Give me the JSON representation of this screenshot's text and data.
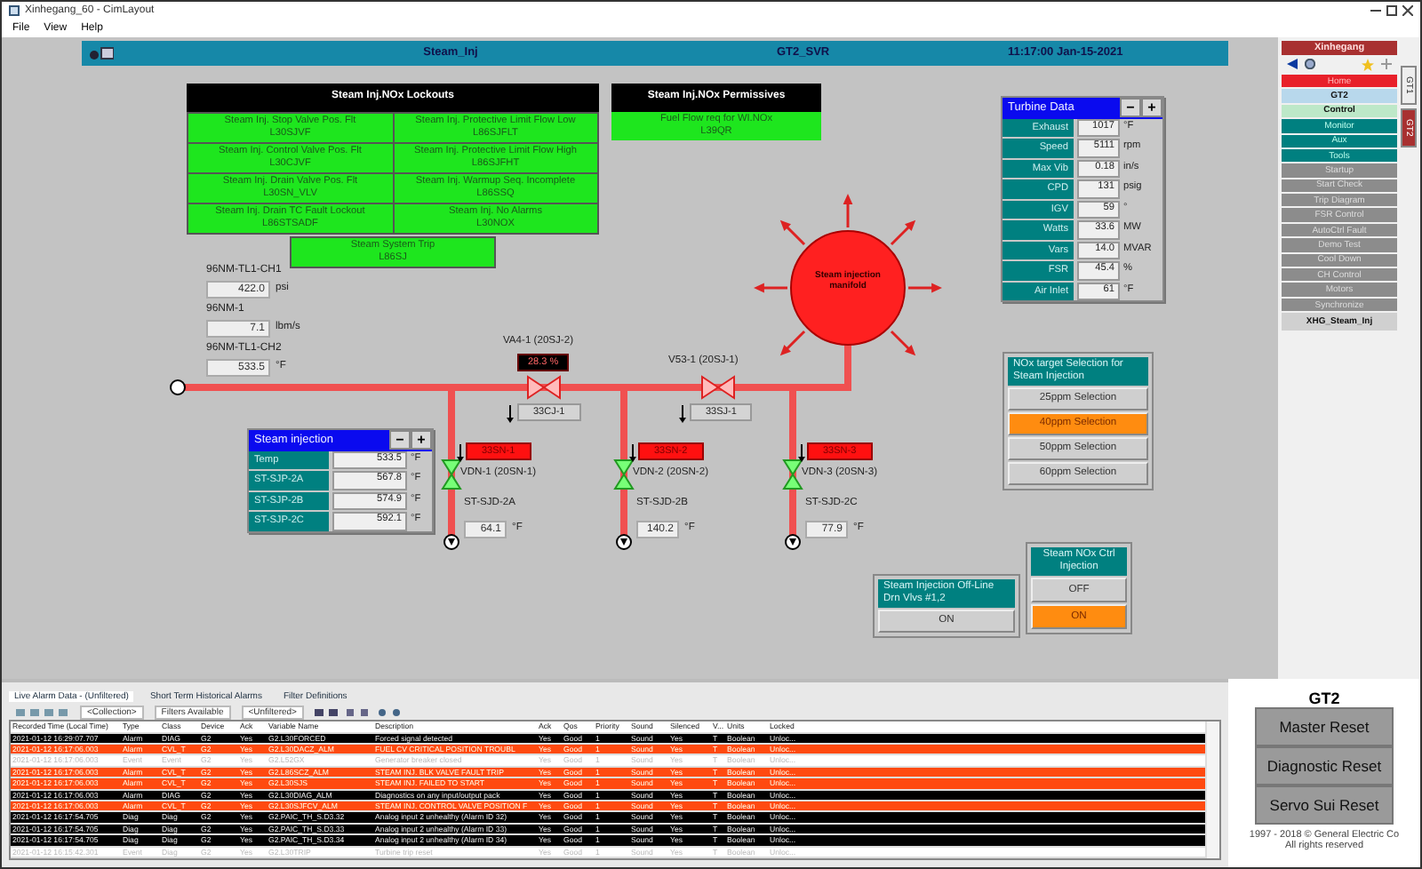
{
  "window": {
    "title": "Xinhegang_60 - CimLayout"
  },
  "menu": [
    "File",
    "View",
    "Help"
  ],
  "header": {
    "screen": "Steam_Inj",
    "server": "GT2_SVR",
    "time": "11:17:00  Jan-15-2021"
  },
  "lockouts": {
    "title": "Steam Inj.NOx Lockouts",
    "cells": [
      {
        "name": "Steam Inj. Stop Valve Pos. Flt",
        "tag": "L30SJVF"
      },
      {
        "name": "Steam Inj. Protective Limit Flow Low",
        "tag": "L86SJFLT"
      },
      {
        "name": "Steam Inj. Control Valve Pos. Flt",
        "tag": "L30CJVF"
      },
      {
        "name": "Steam Inj. Protective Limit Flow High",
        "tag": "L86SJFHT"
      },
      {
        "name": "Steam Inj. Drain Valve Pos. Flt",
        "tag": "L30SN_VLV"
      },
      {
        "name": "Steam Inj. Warmup Seq. Incomplete",
        "tag": "L86SSQ"
      },
      {
        "name": "Steam Inj. Drain TC Fault Lockout",
        "tag": "L86STSADF"
      },
      {
        "name": "Steam Inj. No Alarms",
        "tag": "L30NOX"
      }
    ],
    "trip": {
      "name": "Steam System Trip",
      "tag": "L86SJ"
    }
  },
  "permissives": {
    "title": "Steam Inj.NOx Permissives",
    "cells": [
      {
        "name": "Fuel Flow req for WI.NOx",
        "tag": "L39QR"
      }
    ]
  },
  "turbine_data": {
    "title": "Turbine Data",
    "minus": "−",
    "plus": "+",
    "rows": [
      {
        "label": "Exhaust",
        "value": "1017",
        "unit": "°F"
      },
      {
        "label": "Speed",
        "value": "5111",
        "unit": "rpm"
      },
      {
        "label": "Max Vib",
        "value": "0.18",
        "unit": "in/s"
      },
      {
        "label": "CPD",
        "value": "131",
        "unit": "psig"
      },
      {
        "label": "IGV",
        "value": "59",
        "unit": "°"
      },
      {
        "label": "Watts",
        "value": "33.6",
        "unit": "MW"
      },
      {
        "label": "Vars",
        "value": "14.0",
        "unit": "MVAR"
      },
      {
        "label": "FSR",
        "value": "45.4",
        "unit": "%"
      },
      {
        "label": "Air Inlet",
        "value": "61",
        "unit": "°F"
      }
    ]
  },
  "sensors": [
    {
      "label": "96NM-TL1-CH1",
      "value": "422.0",
      "unit": "psi"
    },
    {
      "label": "96NM-1",
      "value": "7.1",
      "unit": "lbm/s"
    },
    {
      "label": "96NM-TL1-CH2",
      "value": "533.5",
      "unit": "°F"
    }
  ],
  "manifold": {
    "label": "Steam injection manifold"
  },
  "valves": [
    {
      "label": "VA4-1 (20SJ-2)",
      "reading": "28.3 %",
      "tag": "33CJ-1"
    },
    {
      "label": "V53-1 (20SJ-1)",
      "tag": "33SJ-1"
    }
  ],
  "drains": [
    {
      "alarm": "33SN-1",
      "valve": "VDN-1 (20SN-1)",
      "sensor": "ST-SJD-2A",
      "value": "64.1",
      "unit": "°F"
    },
    {
      "alarm": "33SN-2",
      "valve": "VDN-2 (20SN-2)",
      "sensor": "ST-SJD-2B",
      "value": "140.2",
      "unit": "°F"
    },
    {
      "alarm": "33SN-3",
      "valve": "VDN-3 (20SN-3)",
      "sensor": "ST-SJD-2C",
      "value": "77.9",
      "unit": "°F"
    }
  ],
  "steam_injection": {
    "title": "Steam injection",
    "minus": "−",
    "plus": "+",
    "rows": [
      {
        "label": "Temp",
        "value": "533.5",
        "unit": "°F"
      },
      {
        "label": "ST-SJP-2A",
        "value": "567.8",
        "unit": "°F"
      },
      {
        "label": "ST-SJP-2B",
        "value": "574.9",
        "unit": "°F"
      },
      {
        "label": "ST-SJP-2C",
        "value": "592.1",
        "unit": "°F"
      }
    ]
  },
  "nox_selection": {
    "title": "NOx target Selection for Steam Injection",
    "options": [
      {
        "label": "25ppm Selection",
        "selected": false
      },
      {
        "label": "40ppm Selection",
        "selected": true
      },
      {
        "label": "50ppm Selection",
        "selected": false
      },
      {
        "label": "60ppm Selection",
        "selected": false
      }
    ]
  },
  "nox_ctrl": {
    "title": "Steam NOx Ctrl Injection",
    "options": [
      {
        "label": "OFF",
        "selected": false
      },
      {
        "label": "ON",
        "selected": true
      }
    ]
  },
  "offline_drain": {
    "title": "Steam Injection Off-Line Drn Vlvs #1,2",
    "options": [
      {
        "label": "ON",
        "selected": false
      }
    ]
  },
  "nav": {
    "site": "Xinhegang",
    "unit_tabs": [
      {
        "label": "GT1",
        "selected": false
      },
      {
        "label": "GT2",
        "selected": true
      }
    ],
    "items": [
      {
        "label": "Home",
        "kind": "home"
      },
      {
        "label": "GT2",
        "kind": "unit"
      },
      {
        "label": "Control",
        "kind": "current"
      },
      {
        "label": "Monitor",
        "kind": "group"
      },
      {
        "label": "Aux",
        "kind": "group"
      },
      {
        "label": "Tools",
        "kind": "group"
      },
      {
        "label": "Startup",
        "kind": "page"
      },
      {
        "label": "Start Check",
        "kind": "page"
      },
      {
        "label": "Trip Diagram",
        "kind": "page"
      },
      {
        "label": "FSR Control",
        "kind": "page"
      },
      {
        "label": "AutoCtrl Fault",
        "kind": "page"
      },
      {
        "label": "Demo Test",
        "kind": "page"
      },
      {
        "label": "Cool Down",
        "kind": "page"
      },
      {
        "label": "CH Control",
        "kind": "page"
      },
      {
        "label": "Motors",
        "kind": "page"
      },
      {
        "label": "Synchronize",
        "kind": "page"
      },
      {
        "label": "XHG_Steam_Inj",
        "kind": "screen"
      }
    ]
  },
  "alarms": {
    "tabs": [
      {
        "label": "Live Alarm Data - (Unfiltered)",
        "selected": true
      },
      {
        "label": "Short Term Historical Alarms",
        "selected": false
      },
      {
        "label": "Filter Definitions",
        "selected": false
      }
    ],
    "toolbar": [
      "<Collection>",
      "Filters Available",
      "<Unfiltered>"
    ],
    "columns": [
      "Recorded Time (Local Time)",
      "Type",
      "Class",
      "Device",
      "Ack",
      "Variable Name",
      "Description",
      "Ack",
      "Qos",
      "Priority",
      "Sound",
      "Silenced",
      "V...",
      "Units",
      "Locked"
    ],
    "rows": [
      {
        "kind": "active",
        "cells": [
          "2021-01-12 16:29:07.707",
          "Alarm",
          "DIAG",
          "G2",
          "Yes",
          "G2.L30FORCED",
          "Forced signal detected",
          "Yes",
          "Good",
          "1",
          "Sound",
          "Yes",
          "T",
          "Boolean",
          "Unloc..."
        ]
      },
      {
        "kind": "unacked",
        "cells": [
          "2021-01-12 16:17:06.003",
          "Alarm",
          "CVL_T",
          "G2",
          "Yes",
          "G2.L30DACZ_ALM",
          "FUEL CV CRITICAL POSITION TROUBL",
          "Yes",
          "Good",
          "1",
          "Sound",
          "Yes",
          "T",
          "Boolean",
          "Unloc..."
        ]
      },
      {
        "kind": "normal",
        "cells": [
          "2021-01-12 16:17:06.003",
          "Event",
          "Event",
          "G2",
          "Yes",
          "G2.L52GX",
          "Generator breaker closed",
          "Yes",
          "Good",
          "1",
          "Sound",
          "Yes",
          "T",
          "Boolean",
          "Unloc..."
        ]
      },
      {
        "kind": "unacked",
        "cells": [
          "2021-01-12 16:17:06.003",
          "Alarm",
          "CVL_T",
          "G2",
          "Yes",
          "G2.L86SCZ_ALM",
          "STEAM INJ. BLK VALVE FAULT TRIP",
          "Yes",
          "Good",
          "1",
          "Sound",
          "Yes",
          "T",
          "Boolean",
          "Unloc..."
        ]
      },
      {
        "kind": "unacked",
        "cells": [
          "2021-01-12 16:17:06.003",
          "Alarm",
          "CVL_T",
          "G2",
          "Yes",
          "G2.L30SJS",
          "STEAM INJ. FAILED TO START",
          "Yes",
          "Good",
          "1",
          "Sound",
          "Yes",
          "T",
          "Boolean",
          "Unloc..."
        ]
      },
      {
        "kind": "active",
        "cells": [
          "2021-01-12 16:17:06.003",
          "Alarm",
          "DIAG",
          "G2",
          "Yes",
          "G2.L30DIAG_ALM",
          "Diagnostics on any input/output pack",
          "Yes",
          "Good",
          "1",
          "Sound",
          "Yes",
          "T",
          "Boolean",
          "Unloc..."
        ]
      },
      {
        "kind": "unacked",
        "cells": [
          "2021-01-12 16:17:06.003",
          "Alarm",
          "CVL_T",
          "G2",
          "Yes",
          "G2.L30SJFCV_ALM",
          "STEAM INJ. CONTROL VALVE POSITION F",
          "Yes",
          "Good",
          "1",
          "Sound",
          "Yes",
          "T",
          "Boolean",
          "Unloc..."
        ]
      },
      {
        "kind": "active",
        "cells": [
          "2021-01-12 16:17:54.705",
          "Diag",
          "Diag",
          "G2",
          "Yes",
          "G2.PAIC_TH_S.D3.32",
          "Analog input 2 unhealthy (Alarm ID 32)",
          "Yes",
          "Good",
          "1",
          "Sound",
          "Yes",
          "T",
          "Boolean",
          "Unloc..."
        ]
      },
      {
        "kind": "active",
        "cells": [
          "2021-01-12 16:17:54.705",
          "Diag",
          "Diag",
          "G2",
          "Yes",
          "G2.PAIC_TH_S.D3.33",
          "Analog input 2 unhealthy (Alarm ID 33)",
          "Yes",
          "Good",
          "1",
          "Sound",
          "Yes",
          "T",
          "Boolean",
          "Unloc..."
        ]
      },
      {
        "kind": "active",
        "cells": [
          "2021-01-12 16:17:54.705",
          "Diag",
          "Diag",
          "G2",
          "Yes",
          "G2.PAIC_TH_S.D3.34",
          "Analog input 2 unhealthy (Alarm ID 34)",
          "Yes",
          "Good",
          "1",
          "Sound",
          "Yes",
          "T",
          "Boolean",
          "Unloc..."
        ]
      },
      {
        "kind": "normal",
        "cells": [
          "2021-01-12 16:15:42.301",
          "Event",
          "Diag",
          "G2",
          "Yes",
          "G2.L30TRIP",
          "Turbine trip reset",
          "Yes",
          "Good",
          "1",
          "Sound",
          "Yes",
          "T",
          "Boolean",
          "Unloc..."
        ]
      }
    ]
  },
  "resets": {
    "title": "GT2",
    "buttons": [
      "Master Reset",
      "Diagnostic Reset",
      "Servo Sui Reset"
    ],
    "copyright": "1997 - 2018 © General Electric Co",
    "rights": "All rights reserved"
  }
}
